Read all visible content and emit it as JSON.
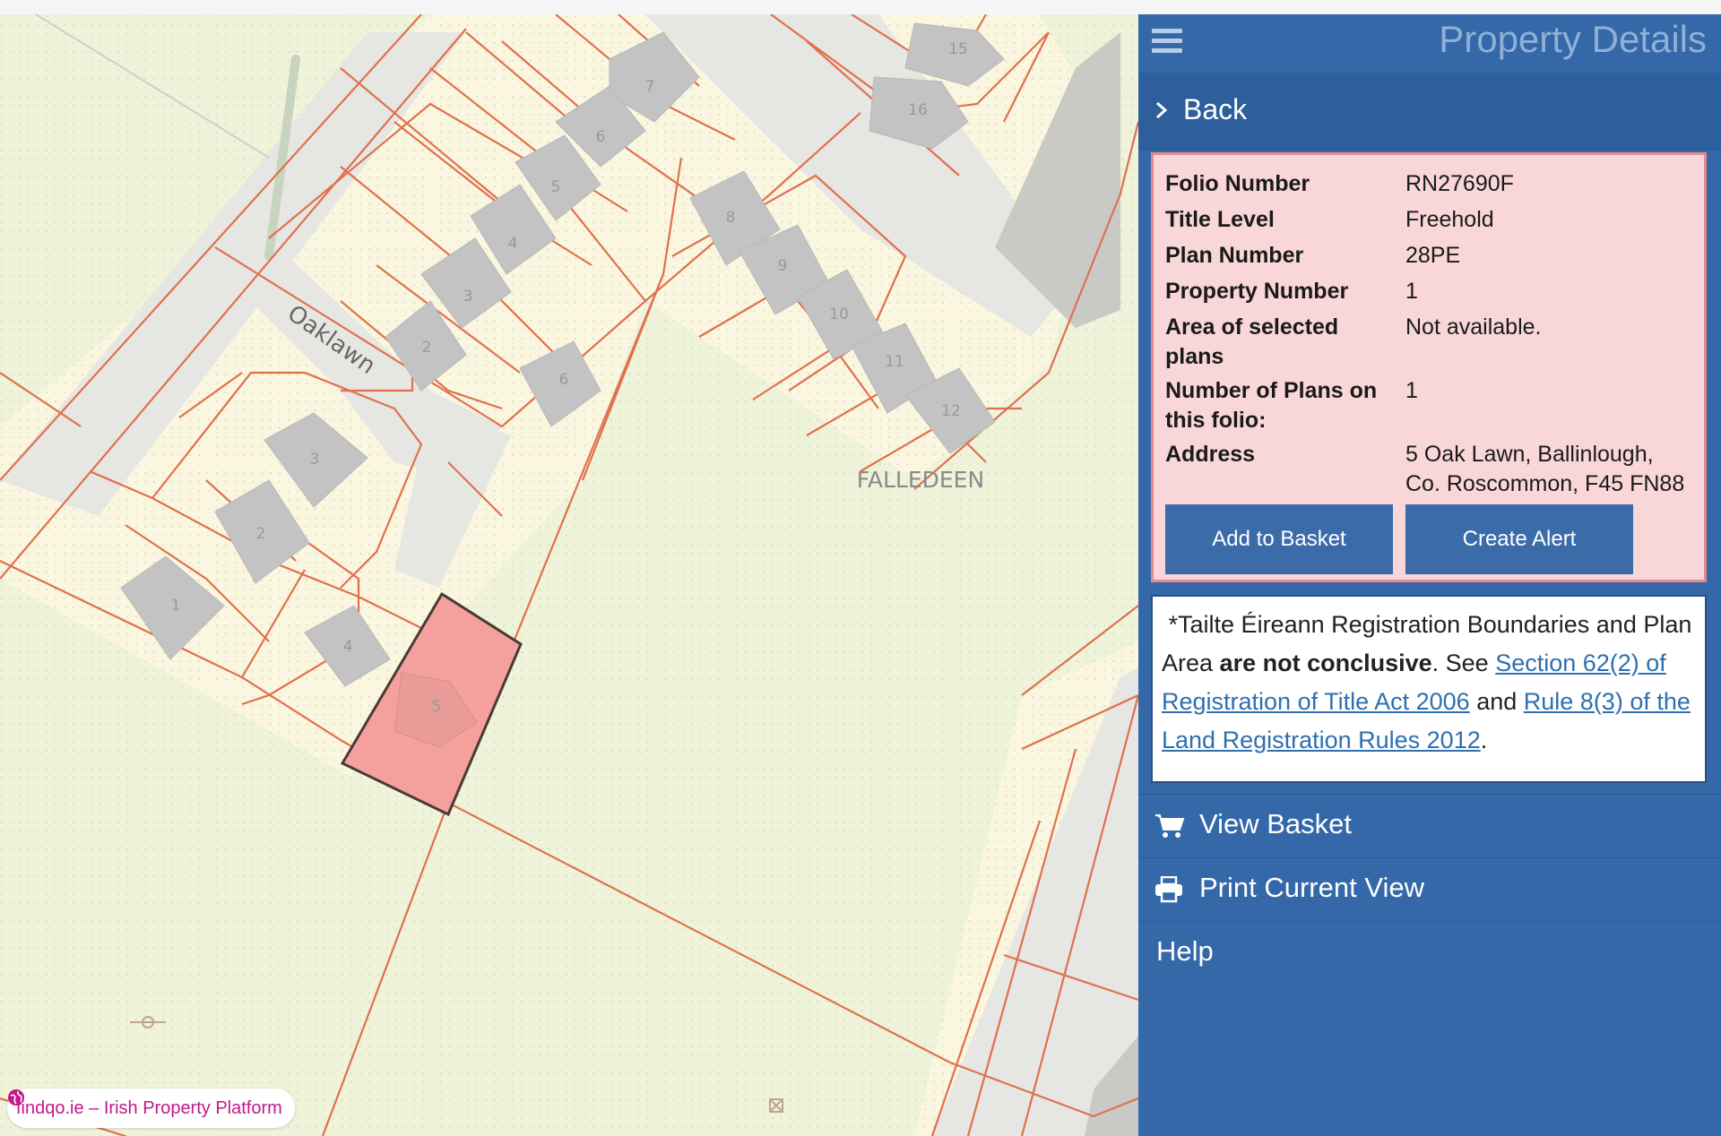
{
  "panel": {
    "title": "Property Details",
    "back_label": "Back"
  },
  "details": {
    "rows": [
      {
        "label": "Folio Number",
        "value": "RN27690F"
      },
      {
        "label": "Title Level",
        "value": "Freehold"
      },
      {
        "label": "Plan Number",
        "value": "28PE"
      },
      {
        "label": "Property Number",
        "value": "1"
      },
      {
        "label": "Area of selected plans",
        "value": "Not available."
      },
      {
        "label": "Number of Plans on this folio:",
        "value": "1"
      },
      {
        "label": "Address",
        "value": "5 Oak Lawn, Ballinlough, Co. Roscommon, F45 FN88"
      }
    ],
    "add_basket_label": "Add to Basket",
    "create_alert_label": "Create Alert"
  },
  "disclaimer": {
    "prefix": "*Tailte Éireann Registration Boundaries and Plan Area ",
    "bold": "are not conclusive",
    "mid": ". See ",
    "link1": "Section 62(2) of Registration of Title Act 2006",
    "and": " and ",
    "link2": "Rule 8(3) of the Land Registration Rules 2012",
    "suffix": "."
  },
  "nav": {
    "view_basket": "View Basket",
    "print_view": "Print Current View",
    "help": "Help"
  },
  "map": {
    "road_label": "Oaklawn",
    "area_label": "FALLEDEEN",
    "house_numbers": [
      "15",
      "16",
      "7",
      "6",
      "5",
      "4",
      "3",
      "2",
      "8",
      "9",
      "10",
      "11",
      "12",
      "6",
      "3",
      "2",
      "1",
      "4",
      "5"
    ],
    "selected_color": "#f4a09c",
    "boundary_color": "#e0704e"
  },
  "brand": {
    "text": "findqo.ie – Irish Property Platform"
  },
  "icons": [
    "menu-icon",
    "chevron-right-icon",
    "cart-icon",
    "print-icon",
    "globe-icon"
  ]
}
